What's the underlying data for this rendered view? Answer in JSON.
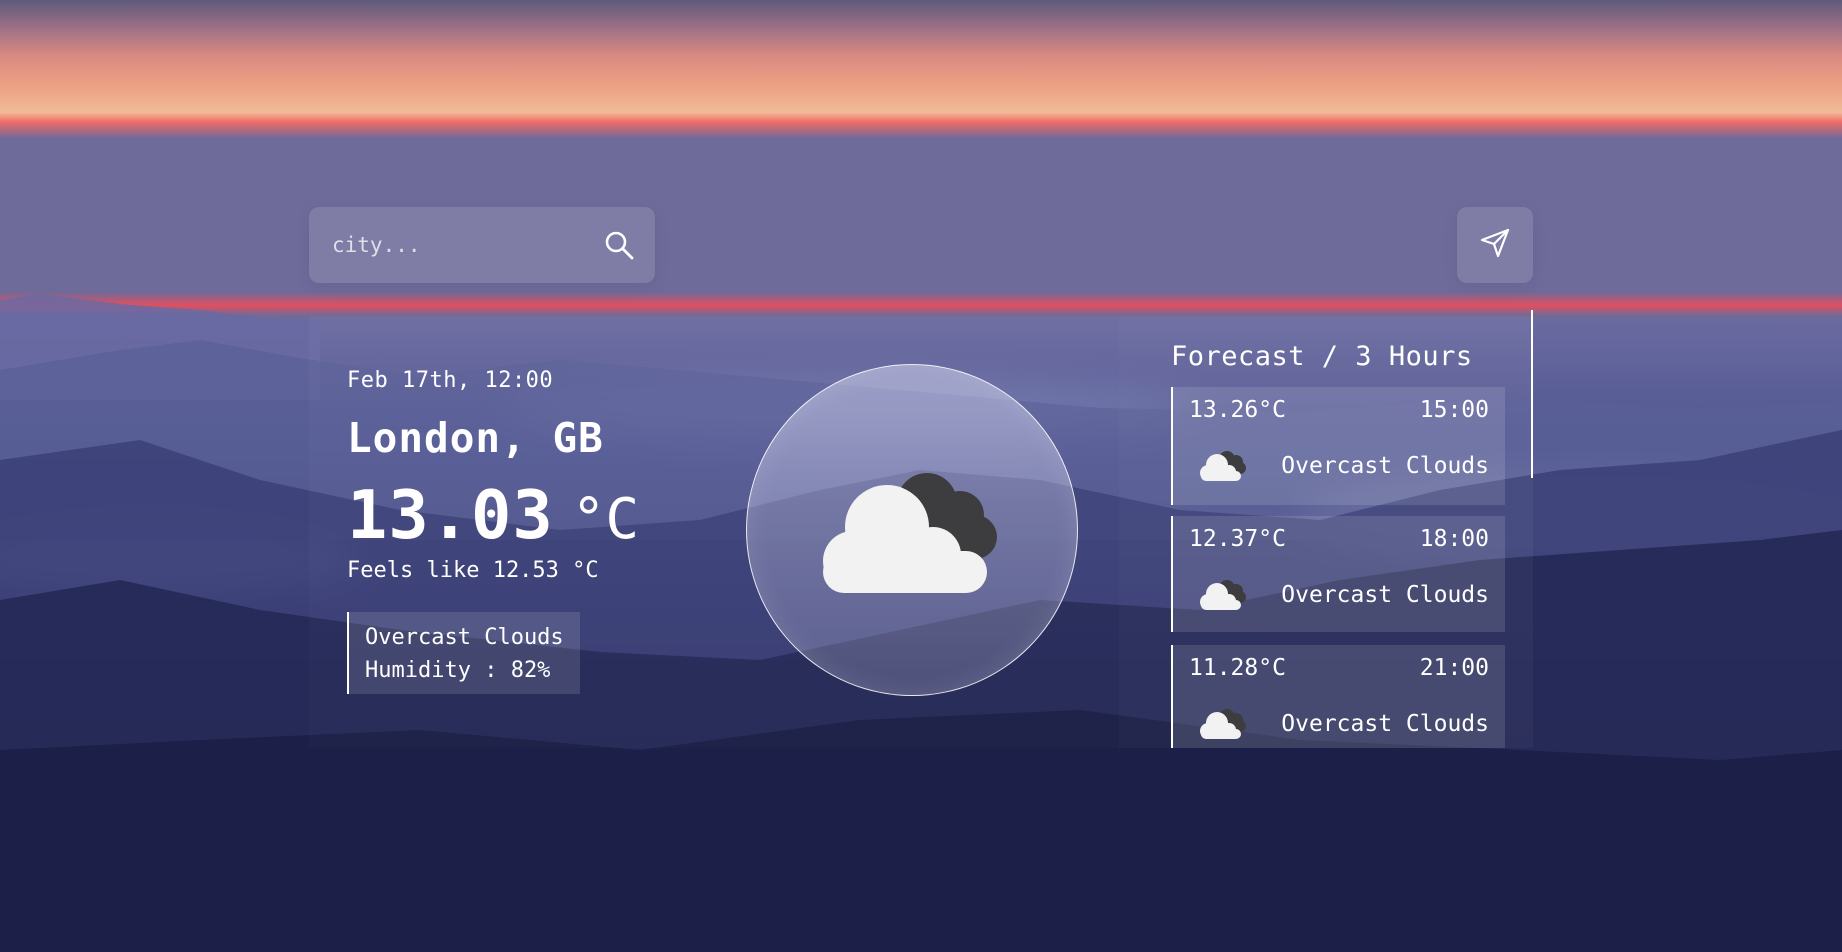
{
  "search": {
    "placeholder": "city...",
    "icon": "search-icon"
  },
  "locate": {
    "icon": "navigation-arrow-icon"
  },
  "current": {
    "date": "Feb 17th, 12:00",
    "city": "London, GB",
    "temp": "13.03",
    "temp_unit": "°C",
    "feels_like": "Feels like 12.53 °C",
    "description": "Overcast Clouds",
    "humidity": "Humidity : 82%",
    "icon": "overcast-clouds-icon"
  },
  "forecast": {
    "title": "Forecast / 3 Hours",
    "items": [
      {
        "temp": "13.26°C",
        "time": "15:00",
        "description": "Overcast Clouds",
        "icon": "overcast-clouds-icon"
      },
      {
        "temp": "12.37°C",
        "time": "18:00",
        "description": "Overcast Clouds",
        "icon": "overcast-clouds-icon"
      },
      {
        "temp": "11.28°C",
        "time": "21:00",
        "description": "Overcast Clouds",
        "icon": "overcast-clouds-icon"
      }
    ]
  },
  "colors": {
    "text": "#ffffff",
    "cloud_light": "#f2f2f2",
    "cloud_dark": "#3d3d3f"
  }
}
